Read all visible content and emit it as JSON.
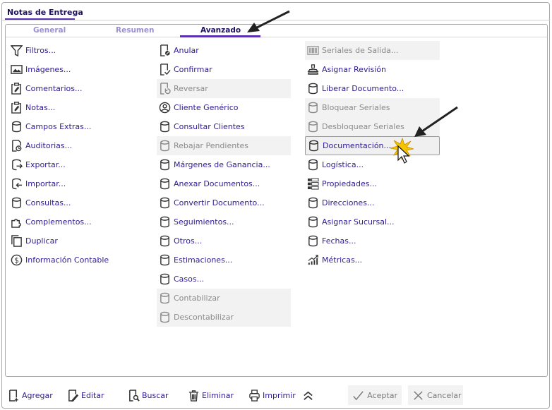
{
  "window": {
    "title": "Notas de Entrega"
  },
  "tabs": [
    {
      "label": "General"
    },
    {
      "label": "Resumen"
    },
    {
      "label": "Avanzado",
      "active": true
    }
  ],
  "columns": [
    [
      {
        "label": "Filtros...",
        "icon": "filter-icon"
      },
      {
        "label": "Imágenes...",
        "icon": "image-icon"
      },
      {
        "label": "Comentarios...",
        "icon": "clipboard-edit-icon"
      },
      {
        "label": "Notas...",
        "icon": "clipboard-edit-icon"
      },
      {
        "label": "Campos Extras...",
        "icon": "database-icon"
      },
      {
        "label": "Auditorias...",
        "icon": "audit-icon"
      },
      {
        "label": "Exportar...",
        "icon": "export-icon"
      },
      {
        "label": "Importar...",
        "icon": "import-icon"
      },
      {
        "label": "Consultas...",
        "icon": "database-icon"
      },
      {
        "label": "Complementos...",
        "icon": "puzzle-icon"
      },
      {
        "label": "Duplicar",
        "icon": "copy-icon"
      },
      {
        "label": "Información Contable",
        "icon": "dollar-icon"
      }
    ],
    [
      {
        "label": "Anular",
        "icon": "document-cancel-icon"
      },
      {
        "label": "Confirmar",
        "icon": "document-check-icon"
      },
      {
        "label": "Reversar",
        "icon": "document-undo-icon",
        "disabled": true
      },
      {
        "label": "Cliente Genérico",
        "icon": "user-circle-icon"
      },
      {
        "label": "Consultar Clientes",
        "icon": "database-icon"
      },
      {
        "label": "Rebajar Pendientes",
        "icon": "database-icon",
        "disabled": true
      },
      {
        "label": "Márgenes de Ganancia...",
        "icon": "database-icon"
      },
      {
        "label": "Anexar Documentos...",
        "icon": "database-icon"
      },
      {
        "label": "Convertir Documento...",
        "icon": "database-icon"
      },
      {
        "label": "Seguimientos...",
        "icon": "database-icon"
      },
      {
        "label": "Otros...",
        "icon": "database-icon"
      },
      {
        "label": "Estimaciones...",
        "icon": "database-icon"
      },
      {
        "label": "Casos...",
        "icon": "database-icon"
      },
      {
        "label": "Contabilizar",
        "icon": "database-icon",
        "disabled": true
      },
      {
        "label": "Descontabilizar",
        "icon": "database-icon",
        "disabled": true
      }
    ],
    [
      {
        "label": "Seriales de Salida...",
        "icon": "barcode-icon",
        "disabled": true
      },
      {
        "label": "Asignar Revisión",
        "icon": "stamp-icon"
      },
      {
        "label": "Liberar Documento...",
        "icon": "database-icon"
      },
      {
        "label": "Bloquear Seriales",
        "icon": "database-icon",
        "disabled": true
      },
      {
        "label": "Desbloquear Seriales",
        "icon": "database-icon",
        "disabled": true
      },
      {
        "label": "Documentación...",
        "icon": "database-icon",
        "hovered": true
      },
      {
        "label": "Logística...",
        "icon": "database-icon"
      },
      {
        "label": "Propiedades...",
        "icon": "properties-icon"
      },
      {
        "label": "Direcciones...",
        "icon": "database-icon"
      },
      {
        "label": "Asignar Sucursal...",
        "icon": "database-icon"
      },
      {
        "label": "Fechas...",
        "icon": "database-icon"
      },
      {
        "label": "Métricas...",
        "icon": "chart-icon"
      }
    ]
  ],
  "toolbar": {
    "agregar": "Agregar",
    "editar": "Editar",
    "buscar": "Buscar",
    "eliminar": "Eliminar",
    "imprimir": "Imprimir",
    "aceptar": "Aceptar",
    "cancelar": "Cancelar"
  },
  "colors": {
    "accent": "#5a2fb0",
    "link": "#2b1b93",
    "disabled": "#8a8a8a"
  }
}
